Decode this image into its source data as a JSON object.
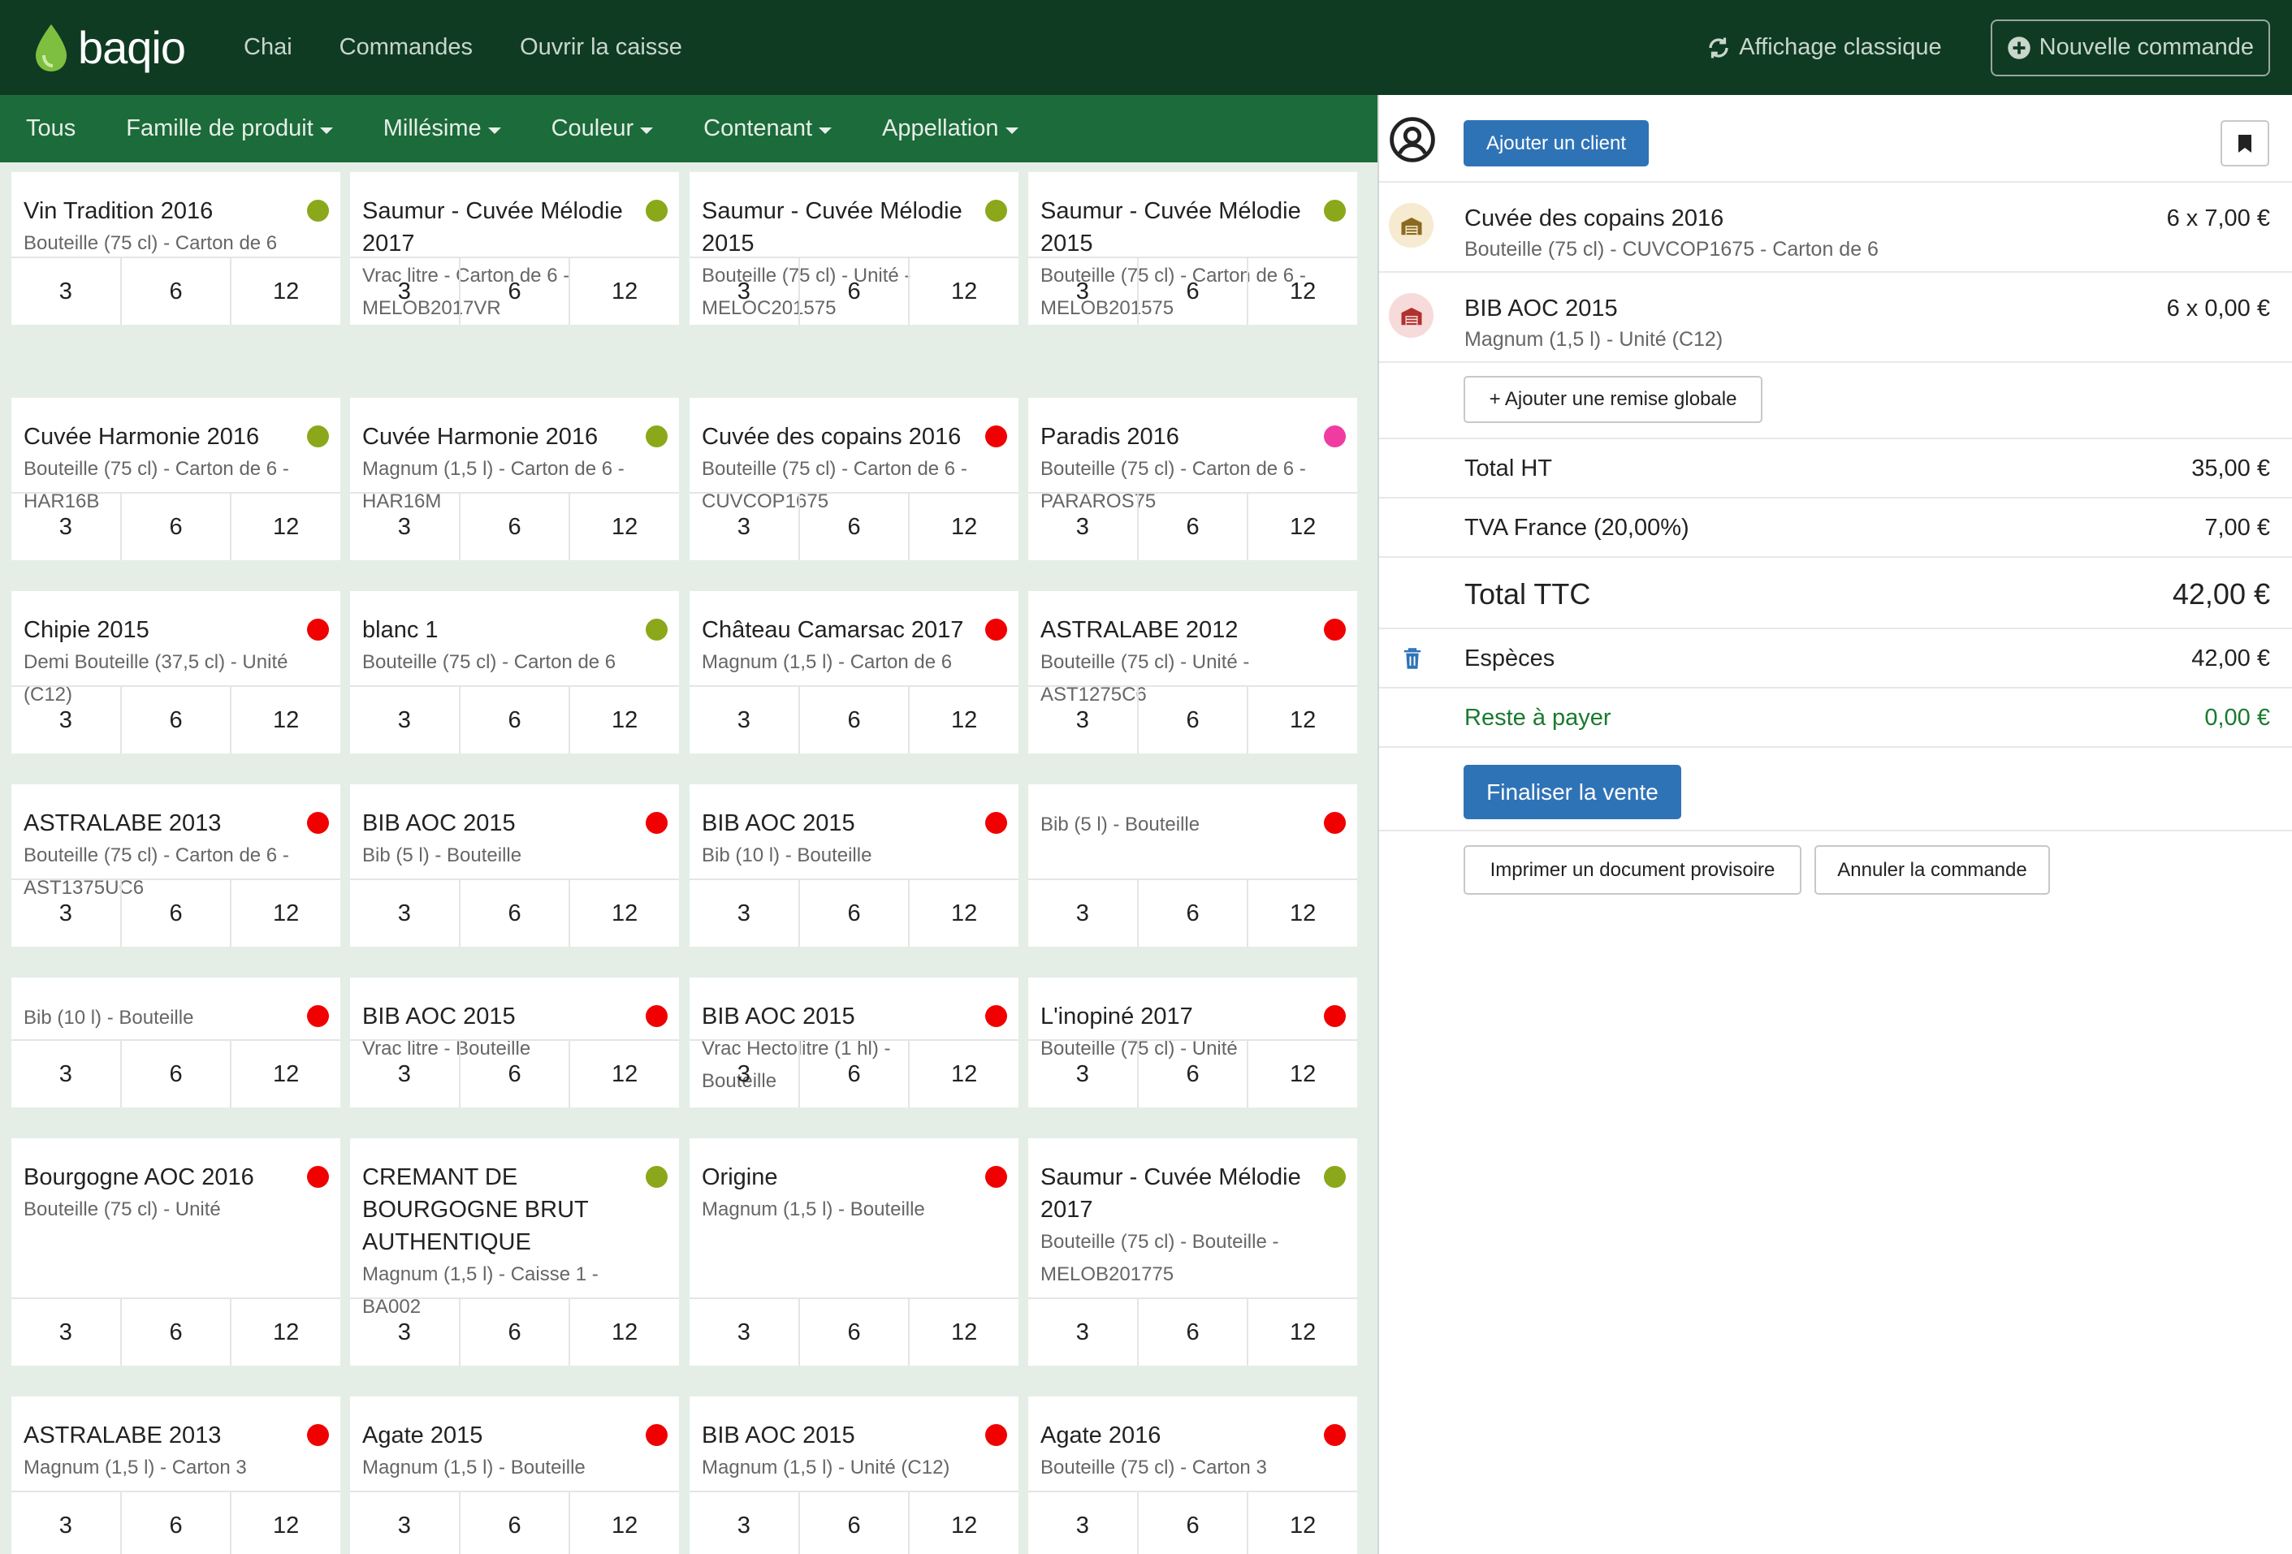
{
  "brand": "baqio",
  "nav": [
    "Chai",
    "Commandes",
    "Ouvrir la caisse"
  ],
  "top_right": {
    "classic_view": "Affichage classique",
    "new_order": "Nouvelle commande"
  },
  "filters": [
    {
      "label": "Tous",
      "dropdown": false
    },
    {
      "label": "Famille de produit",
      "dropdown": true
    },
    {
      "label": "Millésime",
      "dropdown": true
    },
    {
      "label": "Couleur",
      "dropdown": true
    },
    {
      "label": "Contenant",
      "dropdown": true
    },
    {
      "label": "Appellation",
      "dropdown": true
    }
  ],
  "colors": {
    "green": "#8aa81a",
    "red": "#f00000",
    "pink": "#f03ca0",
    "nav_bg": "#0f3b23",
    "filter_bg": "#1c6b3a",
    "primary": "#2f73b7",
    "success": "#1a7a2e"
  },
  "quantities": [
    "3",
    "6",
    "12"
  ],
  "products": [
    [
      {
        "title": "Vin Tradition 2016",
        "sub": "Bouteille (75 cl) - Carton de 6",
        "dot": "green"
      },
      {
        "title": "Saumur - Cuvée Mélodie 2017",
        "sub": "Vrac litre - Carton de 6 - MELOB2017VR",
        "dot": "green"
      },
      {
        "title": "Saumur - Cuvée Mélodie 2015",
        "sub": "Bouteille (75 cl) - Unité - MELOC201575",
        "dot": "green"
      },
      {
        "title": "Saumur - Cuvée Mélodie 2015",
        "sub": "Bouteille (75 cl) - Carton de 6 - MELOB201575",
        "dot": "green"
      }
    ],
    [
      {
        "title": "Cuvée Harmonie 2016",
        "sub": "Bouteille (75 cl) - Carton de 6 - HAR16B",
        "dot": "green"
      },
      {
        "title": "Cuvée Harmonie 2016",
        "sub": "Magnum (1,5 l) - Carton de 6 - HAR16M",
        "dot": "green"
      },
      {
        "title": "Cuvée des copains 2016",
        "sub": "Bouteille (75 cl) - Carton de 6 - CUVCOP1675",
        "dot": "red"
      },
      {
        "title": "Paradis 2016",
        "sub": "Bouteille (75 cl) - Carton de 6 - PARAROS75",
        "dot": "pink"
      }
    ],
    [
      {
        "title": "Chipie 2015",
        "sub": "Demi Bouteille (37,5 cl) - Unité (C12)",
        "dot": "red"
      },
      {
        "title": "blanc 1",
        "sub": "Bouteille (75 cl) - Carton de 6",
        "dot": "green"
      },
      {
        "title": "Château Camarsac 2017",
        "sub": "Magnum (1,5 l) - Carton de 6",
        "dot": "red"
      },
      {
        "title": "ASTRALABE 2012",
        "sub": "Bouteille (75 cl) - Unité - AST1275C6",
        "dot": "red"
      }
    ],
    [
      {
        "title": "ASTRALABE 2013",
        "sub": "Bouteille (75 cl) - Carton de 6 - AST1375UC6",
        "dot": "red"
      },
      {
        "title": "BIB AOC 2015",
        "sub": "Bib (5 l) - Bouteille",
        "dot": "red"
      },
      {
        "title": "BIB AOC 2015",
        "sub": "Bib (10 l) - Bouteille",
        "dot": "red"
      },
      {
        "title": "",
        "sub": "Bib (5 l) - Bouteille",
        "dot": "red"
      }
    ],
    [
      {
        "title": "",
        "sub": "Bib (10 l) - Bouteille",
        "dot": "red"
      },
      {
        "title": "BIB AOC 2015",
        "sub": "Vrac litre - Bouteille",
        "dot": "red"
      },
      {
        "title": "BIB AOC 2015",
        "sub": "Vrac Hectolitre (1 hl) - Bouteille",
        "dot": "red"
      },
      {
        "title": "L'inopiné 2017",
        "sub": "Bouteille (75 cl) - Unité",
        "dot": "red"
      }
    ],
    [
      {
        "title": "Bourgogne AOC 2016",
        "sub": "Bouteille (75 cl) - Unité",
        "dot": "red"
      },
      {
        "title": "CREMANT DE BOURGOGNE BRUT AUTHENTIQUE",
        "sub": "Magnum (1,5 l) - Caisse 1 - BA002",
        "dot": "green"
      },
      {
        "title": "Origine",
        "sub": "Magnum (1,5 l) - Bouteille",
        "dot": "red"
      },
      {
        "title": "Saumur - Cuvée Mélodie 2017",
        "sub": "Bouteille (75 cl) - Bouteille - MELOB201775",
        "dot": "green"
      }
    ],
    [
      {
        "title": "ASTRALABE 2013",
        "sub": "Magnum (1,5 l) - Carton 3",
        "dot": "red"
      },
      {
        "title": "Agate 2015",
        "sub": "Magnum (1,5 l) - Bouteille",
        "dot": "red"
      },
      {
        "title": "BIB AOC 2015",
        "sub": "Magnum (1,5 l) - Unité (C12)",
        "dot": "red"
      },
      {
        "title": "Agate 2016",
        "sub": "Bouteille (75 cl) - Carton 3",
        "dot": "red"
      }
    ]
  ],
  "order": {
    "add_client": "Ajouter un client",
    "lines": [
      {
        "title": "Cuvée des copains 2016",
        "sub": "Bouteille (75 cl) - CUVCOP1675 - Carton de 6",
        "price": "6 x 7,00 €"
      },
      {
        "title": "BIB AOC 2015",
        "sub": "Magnum (1,5 l) - Unité (C12)",
        "price": "6 x 0,00 €"
      }
    ],
    "add_discount": "+ Ajouter une remise globale",
    "total_ht_label": "Total HT",
    "total_ht": "35,00 €",
    "tva_label": "TVA France (20,00%)",
    "tva": "7,00 €",
    "total_ttc_label": "Total TTC",
    "total_ttc": "42,00 €",
    "payment_label": "Espèces",
    "payment": "42,00 €",
    "remaining_label": "Reste à payer",
    "remaining": "0,00 €",
    "finalize": "Finaliser la vente",
    "print": "Imprimer un document provisoire",
    "cancel": "Annuler la commande"
  }
}
